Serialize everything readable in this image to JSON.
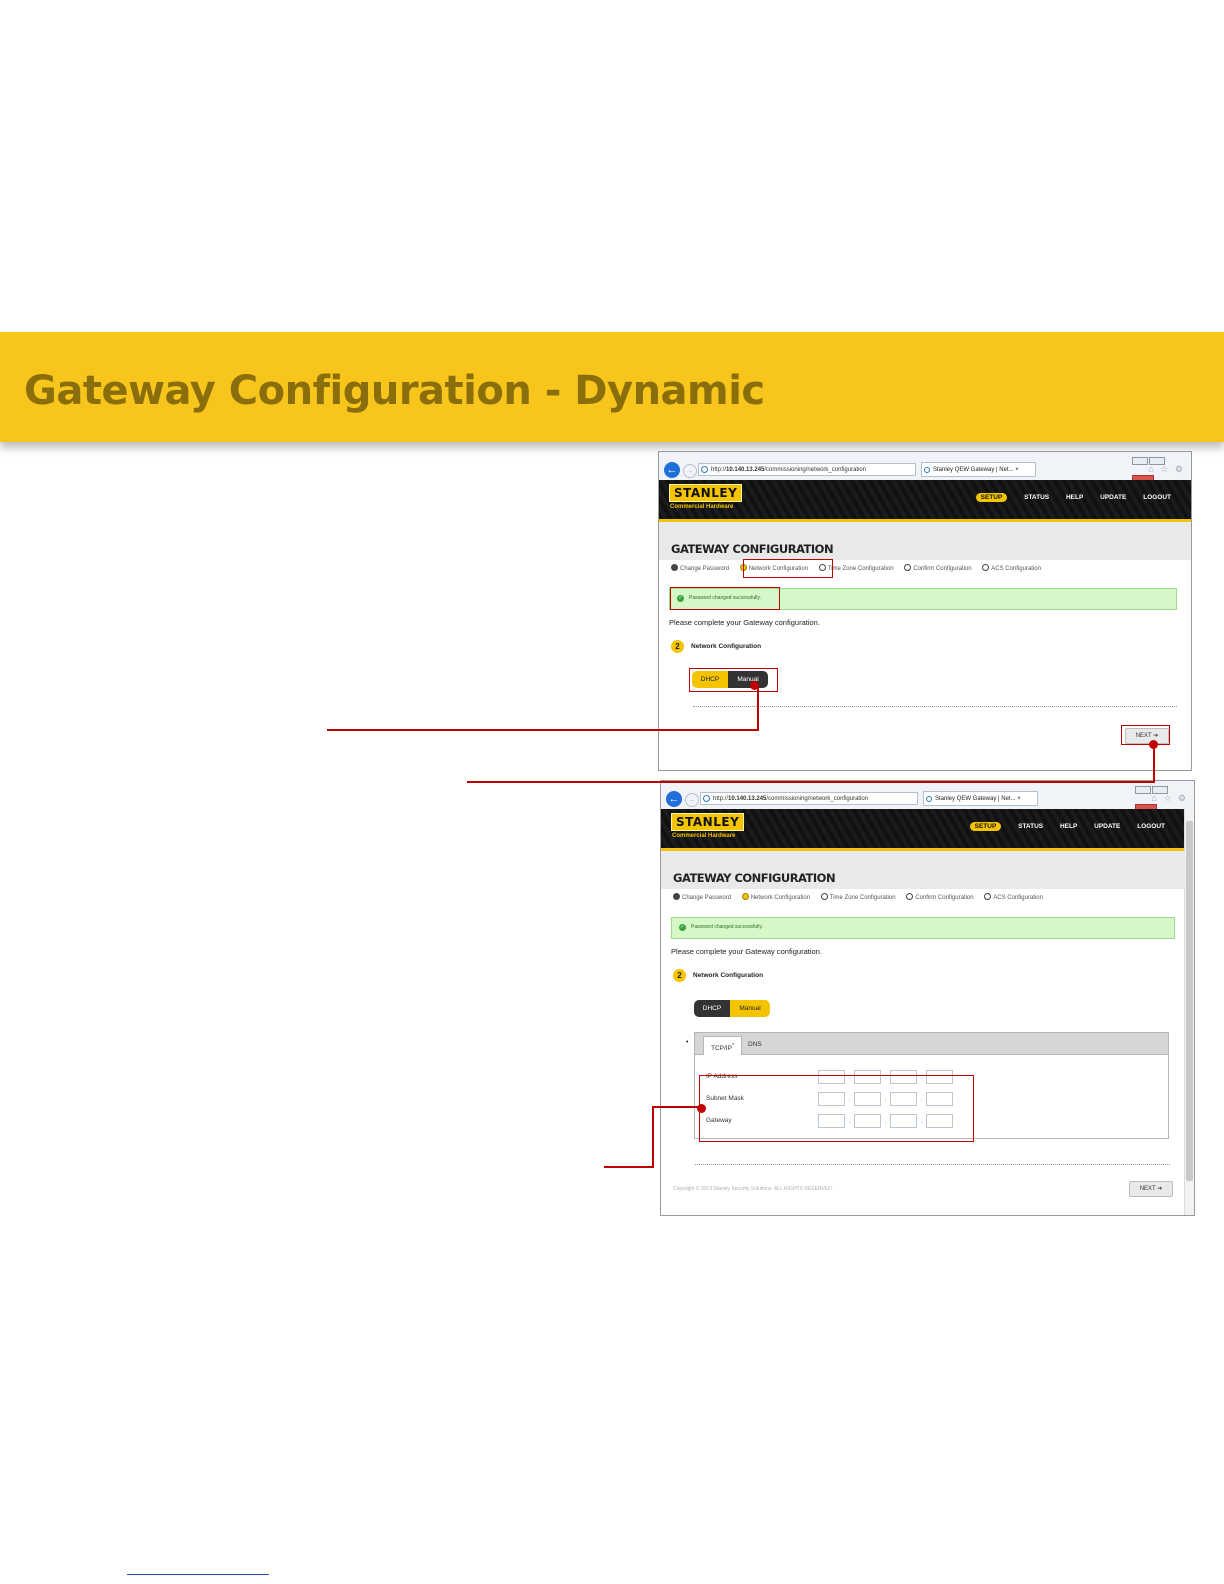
{
  "banner": {
    "title": "Gateway Configuration - Dynamic"
  },
  "browser": {
    "url_prefix": "http://",
    "url_host": "10.140.13.245",
    "url_path": "/commissioning/network_configuration",
    "tab_title": "Stanley QEW Gateway | Net...",
    "tab_close": "×",
    "right_icons": "⌂ ☆ ⚙"
  },
  "site": {
    "logo": "STANLEY",
    "logo_sub": "Commercial Hardware",
    "nav": [
      "SETUP",
      "STATUS",
      "HELP",
      "UPDATE",
      "LOGOUT"
    ],
    "page_title": "GATEWAY CONFIGURATION",
    "steps": [
      "Change Password",
      "Network Configuration",
      "Time Zone Configuration",
      "Confirm Configuration",
      "ACS Configuration"
    ],
    "success_message": "Password changed successfully.",
    "prompt": "Please complete your Gateway configuration.",
    "section_number": "2",
    "section_label": "Network Configuration",
    "toggle": {
      "dhcp": "DHCP",
      "manual": "Manual"
    },
    "next_label": "NEXT ➔"
  },
  "manual_form": {
    "tabs": [
      "TCP/IP",
      "DNS"
    ],
    "tcp_marker": "*",
    "fields": [
      "IP Address",
      "Subnet Mask",
      "Gateway"
    ],
    "separator": ".",
    "bullet": "•",
    "copyright": "Copyright © 2013 Stanley Security Solutions. ALL RIGHTS RESERVED."
  },
  "colors": {
    "banner": "#f8c51c",
    "accent": "#f4c400",
    "callout": "#c00000"
  }
}
